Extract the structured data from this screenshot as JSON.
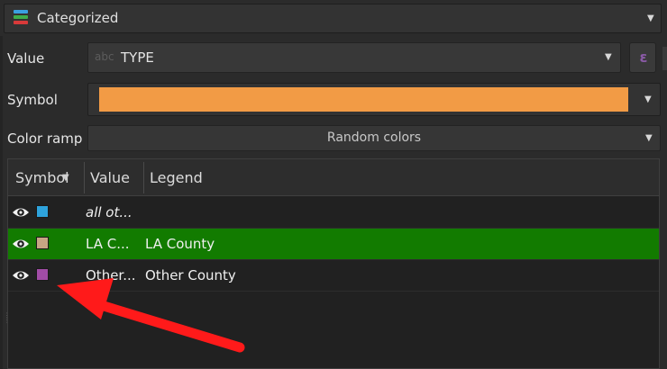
{
  "renderer": {
    "label": "Categorized",
    "icon": "categorized-renderer-icon"
  },
  "value_row": {
    "label": "Value",
    "field_type_hint": "abc",
    "field": "TYPE",
    "expression_icon": "epsilon-expression-icon"
  },
  "symbol_row": {
    "label": "Symbol",
    "color": "#f29b45"
  },
  "color_ramp_row": {
    "label": "Color ramp",
    "value": "Random colors"
  },
  "table": {
    "columns": [
      "Symbol",
      "Value",
      "Legend"
    ],
    "rows": [
      {
        "value": "all ot...",
        "legend": "",
        "color": "#2ea3dc",
        "visible": true,
        "selected": false,
        "italic": true
      },
      {
        "value": "LA C...",
        "legend": "LA County",
        "color": "#c7a584",
        "visible": true,
        "selected": true,
        "italic": false
      },
      {
        "value": "Other...",
        "legend": "Other County",
        "color": "#a14ca6",
        "visible": true,
        "selected": false,
        "italic": false
      }
    ]
  },
  "colors": {
    "selection": "#127b00",
    "annotation_arrow": "#ff1a1a"
  }
}
